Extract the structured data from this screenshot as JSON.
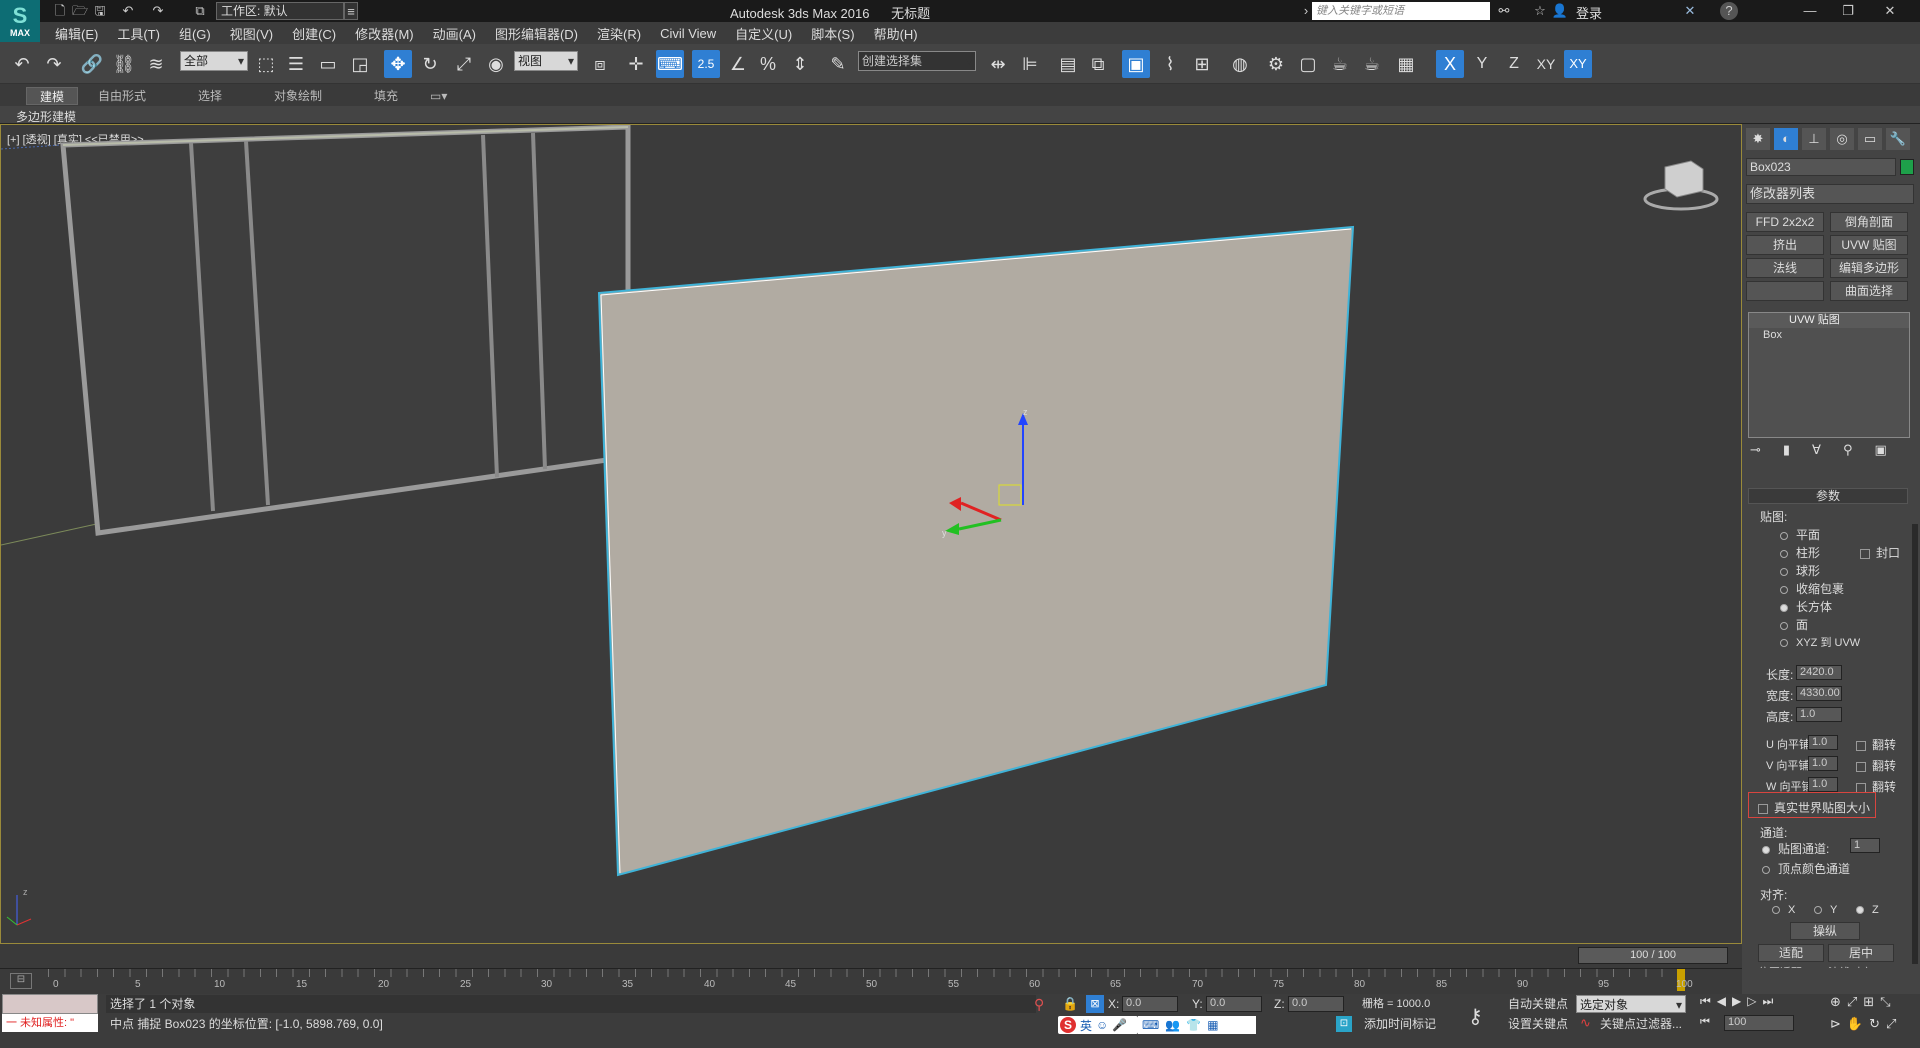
{
  "titlebar": {
    "logo_text": "MAX",
    "workspace": "工作区: 默认",
    "app_title": "Autodesk 3ds Max 2016",
    "doc_title": "无标题",
    "search_placeholder": "键入关键字或短语",
    "login": "登录"
  },
  "menu": [
    "编辑(E)",
    "工具(T)",
    "组(G)",
    "视图(V)",
    "创建(C)",
    "修改器(M)",
    "动画(A)",
    "图形编辑器(D)",
    "渲染(R)",
    "Civil View",
    "自定义(U)",
    "脚本(S)",
    "帮助(H)"
  ],
  "toolbar": {
    "filter": "全部",
    "ref_coord": "视图",
    "snap_value": "2.5",
    "selection_set": "创建选择集",
    "axis_x": "X",
    "axis_y": "Y",
    "axis_z": "Z",
    "axis_xy": "XY",
    "axis_xy2": "XY"
  },
  "ribbon": {
    "tabs": [
      "建模",
      "自由形式",
      "选择",
      "对象绘制",
      "填充"
    ],
    "sub": "多边形建模"
  },
  "viewport": {
    "label": "[+] [透视] [真实] <<已禁用>>",
    "axis_z": "z",
    "axis_y": "y",
    "axis_x": "x"
  },
  "command_panel": {
    "object_name": "Box023",
    "modifier_list": "修改器列表",
    "modifier_buttons": [
      "FFD 2x2x2",
      "倒角剖面",
      "挤出",
      "UVW 贴图",
      "法线",
      "编辑多边形",
      "",
      "曲面选择"
    ],
    "stack": [
      "UVW 贴图",
      "Box"
    ],
    "rollout_title": "参数",
    "mapping_label": "贴图:",
    "mapping_options": [
      "平面",
      "柱形",
      "球形",
      "收缩包裹",
      "长方体",
      "面",
      "XYZ 到 UVW"
    ],
    "mapping_selected": "长方体",
    "cap_label": "封口",
    "length_label": "长度:",
    "length": "2420.0",
    "width_label": "宽度:",
    "width": "4330.00",
    "height_label": "高度:",
    "height": "1.0",
    "u_label": "U 向平铺",
    "u_value": "1.0",
    "v_label": "V 向平铺",
    "v_value": "1.0",
    "w_label": "W 向平铺",
    "w_value": "1.0",
    "flip_label": "翻转",
    "real_world": "真实世界贴图大小",
    "channel_label": "通道:",
    "map_channel": "贴图通道:",
    "map_channel_value": "1",
    "vertex_color": "顶点颜色通道",
    "align_label": "对齐:",
    "align_x": "X",
    "align_y": "Y",
    "align_z": "Z",
    "manipulate": "操纵",
    "fit": "适配",
    "center": "居中",
    "bottom_partial_1": "位图适配",
    "bottom_partial_2": "法线对齐"
  },
  "timeline": {
    "frame": "100 / 100",
    "ticks": [
      "0",
      "5",
      "10",
      "15",
      "20",
      "25",
      "30",
      "35",
      "40",
      "45",
      "50",
      "55",
      "60",
      "65",
      "70",
      "75",
      "80",
      "85",
      "90",
      "95",
      "100"
    ]
  },
  "status": {
    "unknown_attr": "一 未知属性: \"",
    "selected": "选择了 1 个对象",
    "prompt": "中点 捕捉 Box023 的坐标位置: [-1.0, 5898.769, 0.0]",
    "x_label": "X:",
    "x": "0.0",
    "y_label": "Y:",
    "y": "0.0",
    "z_label": "Z:",
    "z": "0.0",
    "grid": "栅格 = 1000.0",
    "add_time_tag": "添加时间标记",
    "auto_key": "自动关键点",
    "selected_obj": "选定对象",
    "set_key": "设置关键点",
    "key_filters": "关键点过滤器...",
    "frame_value": "100",
    "ime": "英"
  }
}
